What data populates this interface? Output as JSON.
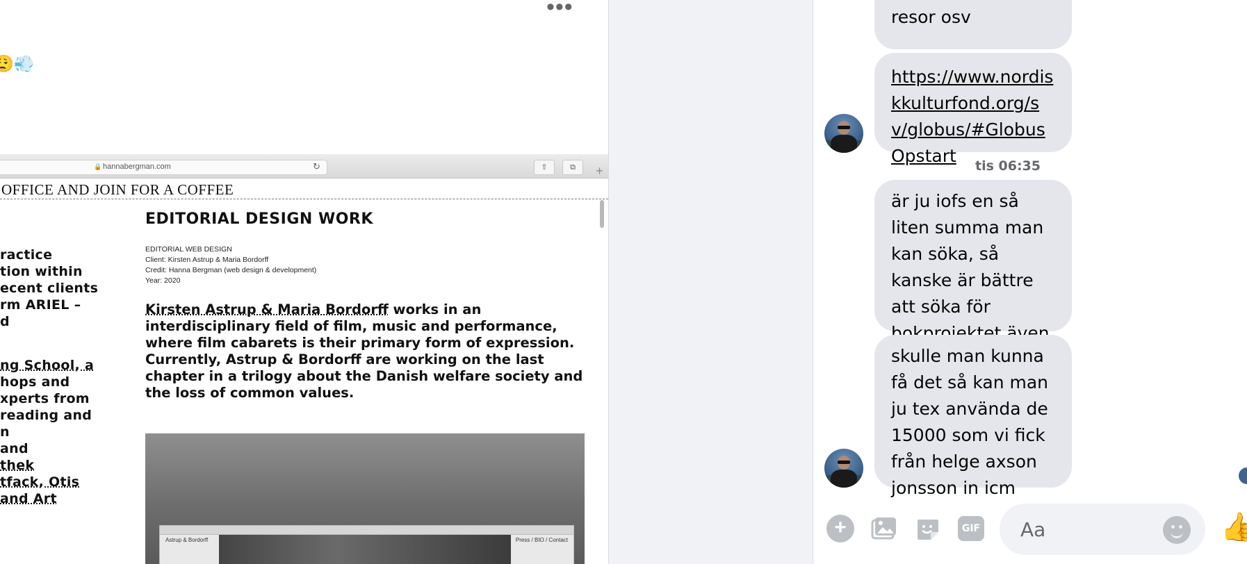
{
  "post": {
    "more_label": "•••",
    "emojis": "😮‍💨💨"
  },
  "screenshot": {
    "url": "hannabergman.com",
    "lock_glyph": "🔒",
    "reload_glyph": "↻",
    "share_glyph": "⇧",
    "tabs_glyph": "⧉",
    "plus_glyph": "+",
    "banner": "OFFICE AND JOIN FOR A COFFEE",
    "left_column": [
      "ractice",
      "tion within",
      "ecent clients",
      "rm ARIEL –",
      "d",
      "ng School, a",
      "hops and",
      "xperts from",
      "reading and",
      "n",
      " and",
      "thek",
      "tfack, Otis",
      "and Art"
    ],
    "section_title": "EDITORIAL DESIGN WORK",
    "meta": [
      "EDITORIAL WEB DESIGN",
      "Client: Kirsten Astrup & Maria Bordorff",
      "Credit: Hanna Bergman (web design & development)",
      "Year: 2020"
    ],
    "body_link": "Kirsten Astrup & Maria Bordorff",
    "body_text": " works in an interdisciplinary field of film, music and performance, where film cabarets is their primary form of expression. Currently, Astrup & Bordorff are working on the last chapter in a trilogy about the Danish welfare society and the loss of common values.",
    "inner_left": "Astrup & Bordorff",
    "inner_right": "Press / BIO / Contact"
  },
  "chat": {
    "messages": [
      {
        "text": "bill typ enklare med resor osv"
      },
      {
        "link": "https://www.nordiskkulturfond.org/sv/globus/#GlobusOpstart"
      },
      {
        "text": "är ju iofs en så liten summa man kan söka, så kanske är bättre att söka för bokprojektet även där?"
      },
      {
        "text": "skulle man kunna få det så kan man ju tex använda de 15000 som vi fick från helge axson jonsson in icm"
      }
    ],
    "timestamp": "tis 06:35",
    "composer": {
      "placeholder": "Aa",
      "gif_label": "GIF",
      "plus_label": "+",
      "like_glyph": "👍"
    }
  }
}
